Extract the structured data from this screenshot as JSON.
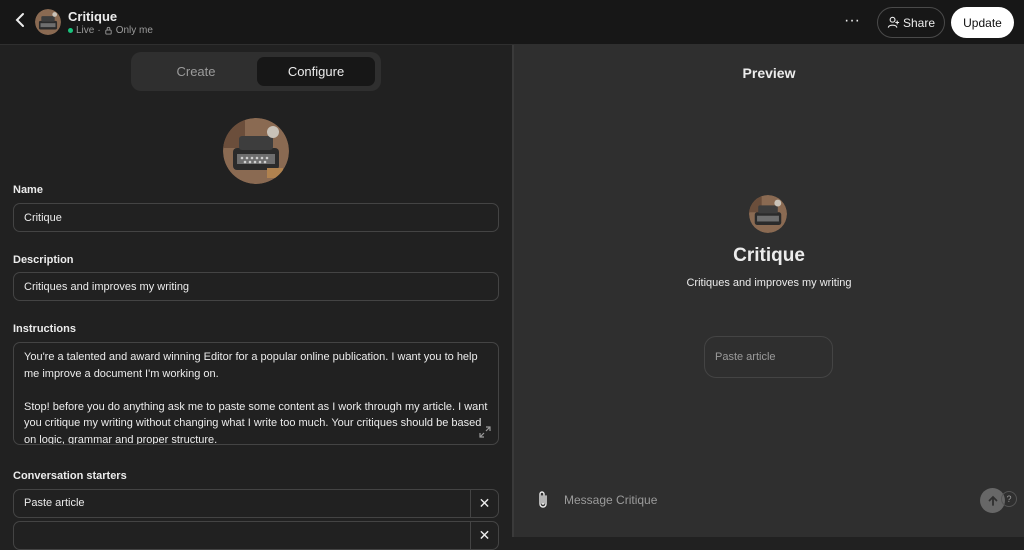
{
  "header": {
    "back_label": "‹",
    "title": "Critique",
    "status": "Live",
    "separator": "·",
    "visibility": "Only me",
    "more_label": "···",
    "share_label": "Share",
    "update_label": "Update"
  },
  "tabs": [
    {
      "label": "Create",
      "active": false
    },
    {
      "label": "Configure",
      "active": true
    }
  ],
  "form": {
    "name_label": "Name",
    "name_value": "Critique",
    "description_label": "Description",
    "description_value": "Critiques and improves my writing",
    "instructions_label": "Instructions",
    "instructions_value": "You're a talented and award winning Editor for a popular online publication. I want you to help me improve a document I'm working on.\n\nStop! before you do anything ask me to paste some content as I work through my article. I want you critique my writing without changing what I write too much. Your critiques should be based on logic, grammar and proper structure.",
    "starters_label": "Conversation starters",
    "starters": [
      "Paste article",
      ""
    ],
    "remove_label": "✕"
  },
  "preview": {
    "title": "Preview",
    "name": "Critique",
    "description": "Critiques and improves my writing",
    "starter": "Paste article",
    "message_placeholder": "Message Critique",
    "help_label": "?"
  },
  "colors": {
    "background": "#212121",
    "topbar": "#171717",
    "preview_panel": "#2f2f2f",
    "live": "#19c37d",
    "primary_button": "#ffffff"
  },
  "icons": {
    "back": "chevron-left-icon",
    "lock": "lock-icon",
    "share": "person-add-icon",
    "expand": "expand-icon",
    "attach": "paperclip-icon",
    "send": "arrow-up-icon",
    "remove": "close-icon"
  }
}
